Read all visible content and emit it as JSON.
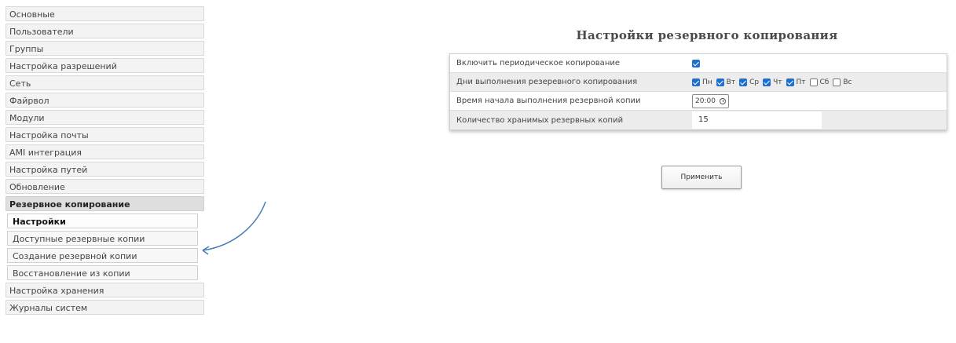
{
  "sidebar": {
    "items": [
      {
        "label": "Основные"
      },
      {
        "label": "Пользователи"
      },
      {
        "label": "Группы"
      },
      {
        "label": "Настройка разрешений"
      },
      {
        "label": "Сеть"
      },
      {
        "label": "Файрвол"
      },
      {
        "label": "Модули"
      },
      {
        "label": "Настройка почты"
      },
      {
        "label": "AMI интеграция"
      },
      {
        "label": "Настройка путей"
      },
      {
        "label": "Обновление"
      }
    ],
    "section": {
      "label": "Резервное копирование"
    },
    "submenu": [
      {
        "label": "Настройки",
        "active": true
      },
      {
        "label": "Доступные резервные копии"
      },
      {
        "label": "Создание резервной копии"
      },
      {
        "label": "Восстановление из копии"
      }
    ],
    "items_after": [
      {
        "label": "Настройка хранения"
      },
      {
        "label": "Журналы систем"
      }
    ]
  },
  "panel": {
    "title": "Настройки резервного копирования",
    "rows": {
      "enable": {
        "label": "Включить периодическое копирование",
        "checked": true
      },
      "days": {
        "label": "Дни выполнения резеревного копирования",
        "items": [
          {
            "label": "Пн",
            "checked": true
          },
          {
            "label": "Вт",
            "checked": true
          },
          {
            "label": "Ср",
            "checked": true
          },
          {
            "label": "Чт",
            "checked": true
          },
          {
            "label": "Пт",
            "checked": true
          },
          {
            "label": "Сб",
            "checked": false
          },
          {
            "label": "Вс",
            "checked": false
          }
        ]
      },
      "time": {
        "label": "Время начала выполнения резервной копии",
        "value": "20:00"
      },
      "count": {
        "label": "Количество хранимых резервных копий",
        "value": "15"
      }
    },
    "apply_label": "Применить"
  },
  "colors": {
    "accent": "#1f6fcf",
    "arrow": "#4a7fb8"
  }
}
